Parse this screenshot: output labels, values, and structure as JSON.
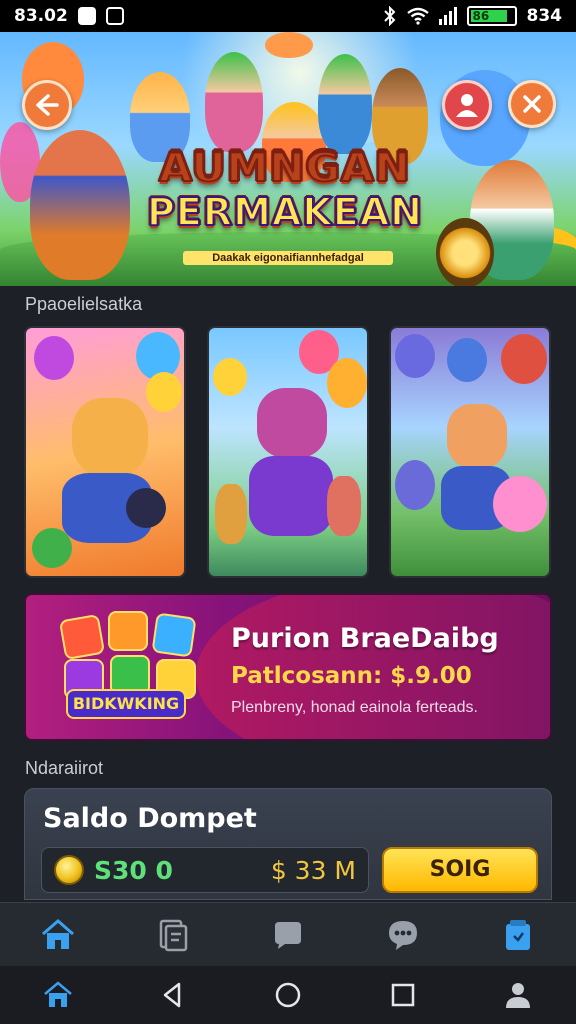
{
  "status_bar": {
    "time": "83.02",
    "battery_text": "86",
    "battery_level": 0.86,
    "right_text": "834"
  },
  "hero": {
    "title_line1": "AUMNGAN",
    "title_line2": "PERMAKEAN",
    "subtitle": "Daakak eigonaifiannhefadgal"
  },
  "games_section": {
    "label": "Ppaoelielsatka"
  },
  "promo": {
    "badge": "BIDKWKING",
    "title": "Purion BraeDaibg",
    "price": "Patlcosann: $.9.00",
    "description": "Plenbreny, honad eainola ferteads."
  },
  "wallet_section": {
    "label": "Ndaraiirot"
  },
  "wallet": {
    "title": "Saldo Dompet",
    "balance": "S30 0",
    "value": "$ 33 M",
    "button_label": "SOIG"
  },
  "colors": {
    "accent": "#ffc21a",
    "tab_active": "#3aa0f0",
    "balance_green": "#5ee07a"
  },
  "tabs": [
    {
      "icon": "home-icon",
      "active": true
    },
    {
      "icon": "library-icon",
      "active": false
    },
    {
      "icon": "chat-icon",
      "active": false
    },
    {
      "icon": "community-icon",
      "active": false
    },
    {
      "icon": "bag-icon",
      "active": false
    }
  ],
  "system_nav": [
    {
      "icon": "home-icon"
    },
    {
      "icon": "back-icon"
    },
    {
      "icon": "circle-home-icon"
    },
    {
      "icon": "recents-icon"
    },
    {
      "icon": "person-icon"
    }
  ]
}
